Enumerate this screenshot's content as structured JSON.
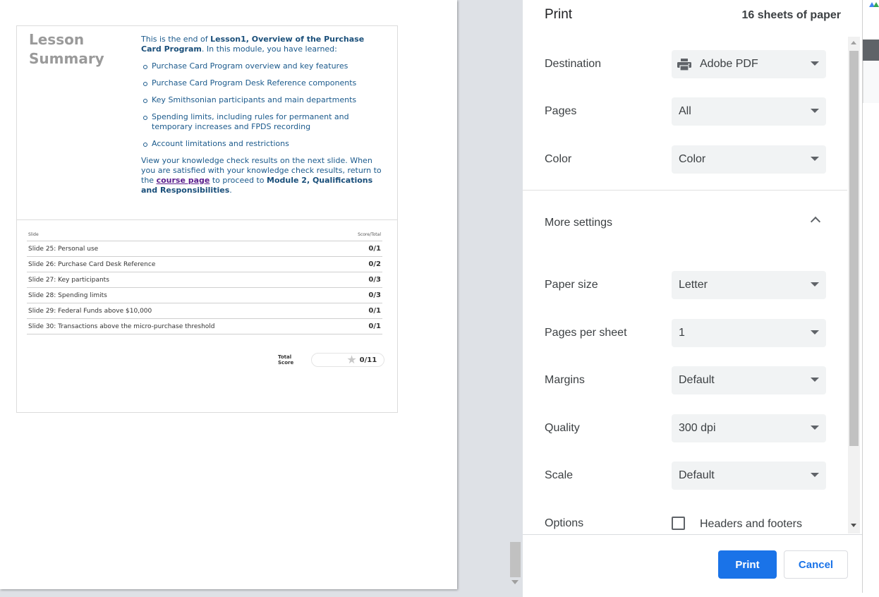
{
  "preview": {
    "lesson": {
      "title": "Lesson Summary",
      "intro_prefix": "This is the end of ",
      "intro_bold": "Lesson1, Overview of the Purchase Card Program",
      "intro_suffix": ". In this module, you have learned:",
      "items": [
        "Purchase Card Program overview and key features",
        "Purchase Card Program Desk Reference components",
        "Key Smithsonian participants and main departments",
        "Spending limits, including rules for permanent and temporary increases and FPDS recording",
        "Account limitations and restrictions"
      ],
      "outro_prefix": "View your knowledge check results on the next slide. When you are satisfied with your knowledge check results, return to the ",
      "outro_link": "course page",
      "outro_mid": " to proceed to ",
      "outro_bold": "Module 2, Qualifications and Responsibilities",
      "outro_end": "."
    },
    "results": {
      "col_slide": "Slide",
      "col_score": "Score/Total",
      "rows": [
        {
          "slide": "Slide 25: Personal use",
          "score": "0/1"
        },
        {
          "slide": "Slide 26: Purchase Card Desk Reference",
          "score": "0/2"
        },
        {
          "slide": "Slide 27: Key participants",
          "score": "0/3"
        },
        {
          "slide": "Slide 28: Spending limits",
          "score": "0/3"
        },
        {
          "slide": "Slide 29: Federal Funds above $10,000",
          "score": "0/1"
        },
        {
          "slide": "Slide 30: Transactions above the micro-purchase threshold",
          "score": "0/1"
        }
      ],
      "total_label": "Total Score",
      "total_value": "0/11"
    }
  },
  "dialog": {
    "title": "Print",
    "sheet_count": "16 sheets of paper",
    "settings": [
      {
        "label": "Destination",
        "value": "Adobe PDF",
        "icon": "printer-icon"
      },
      {
        "label": "Pages",
        "value": "All"
      },
      {
        "label": "Color",
        "value": "Color"
      }
    ],
    "more_settings_label": "More settings",
    "more": [
      {
        "label": "Paper size",
        "value": "Letter"
      },
      {
        "label": "Pages per sheet",
        "value": "1"
      },
      {
        "label": "Margins",
        "value": "Default"
      },
      {
        "label": "Quality",
        "value": "300 dpi"
      },
      {
        "label": "Scale",
        "value": "Default"
      }
    ],
    "options_label": "Options",
    "headers_footers_label": "Headers and footers",
    "print_label": "Print",
    "cancel_label": "Cancel"
  },
  "colors": {
    "accent": "#1a73e8",
    "lesson_text": "#1b5a8c",
    "link": "#5a1e8c"
  }
}
